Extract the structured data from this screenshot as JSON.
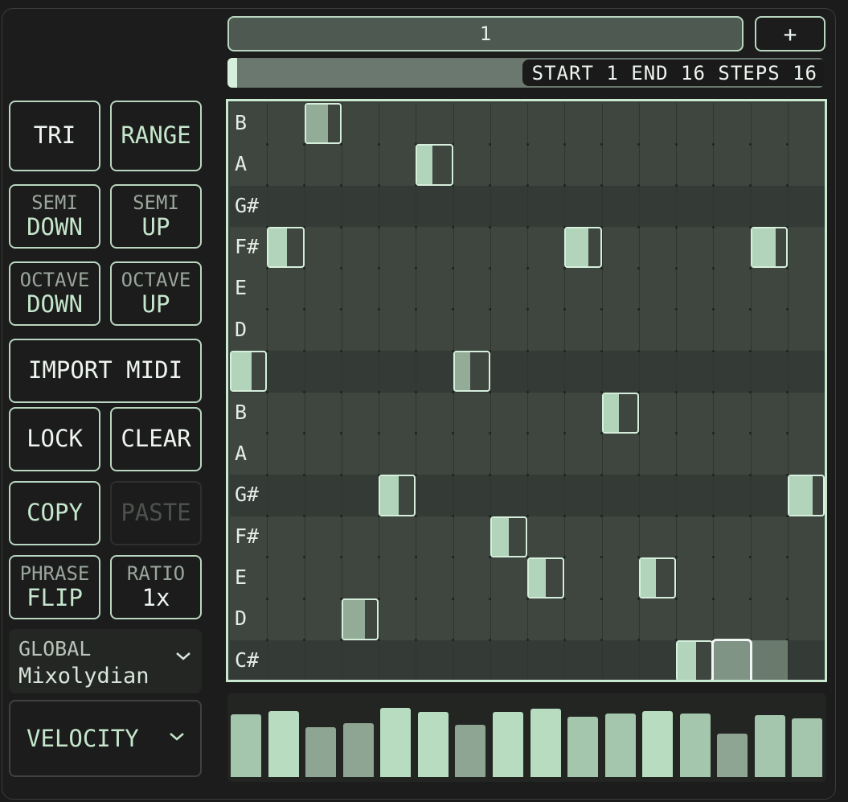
{
  "pattern": {
    "label": "1",
    "add_label": "+"
  },
  "range": {
    "text": "START 1 END 16 STEPS 16"
  },
  "buttons": {
    "tri": "TRI",
    "range": "RANGE",
    "semi_down": {
      "top": "SEMI",
      "bottom": "DOWN"
    },
    "semi_up": {
      "top": "SEMI",
      "bottom": "UP"
    },
    "octave_down": {
      "top": "OCTAVE",
      "bottom": "DOWN"
    },
    "octave_up": {
      "top": "OCTAVE",
      "bottom": "UP"
    },
    "import_midi": "IMPORT MIDI",
    "lock": "LOCK",
    "clear": "CLEAR",
    "copy": "COPY",
    "paste": "PASTE",
    "phrase_flip": {
      "top": "PHRASE",
      "bottom": "FLIP"
    },
    "ratio": {
      "top": "RATIO",
      "bottom": "1x"
    }
  },
  "scale": {
    "label": "GLOBAL",
    "value": "Mixolydian"
  },
  "lane": {
    "label": "VELOCITY"
  },
  "icons": {
    "dropdown": "chevron-down-icon",
    "add": "plus-icon"
  },
  "colors": {
    "accent": "#b9d6c0",
    "note": "#b2d4ba",
    "grid_dark": "#343a35",
    "grid_light": "#3e463f"
  },
  "note_rows": [
    "B",
    "A",
    "G#",
    "F#",
    "E",
    "D",
    "C#",
    "B",
    "A",
    "G#",
    "F#",
    "E",
    "D",
    "C#"
  ],
  "steps": 16,
  "notes": [
    {
      "step": 2,
      "row": 0,
      "fill": 0.65,
      "muted": true
    },
    {
      "step": 5,
      "row": 1,
      "fill": 0.45,
      "muted": false
    },
    {
      "step": 1,
      "row": 3,
      "fill": 0.55,
      "muted": false
    },
    {
      "step": 9,
      "row": 3,
      "fill": 0.65,
      "muted": false
    },
    {
      "step": 14,
      "row": 3,
      "fill": 0.7,
      "muted": false
    },
    {
      "step": 0,
      "row": 6,
      "fill": 0.6,
      "muted": false
    },
    {
      "step": 6,
      "row": 6,
      "fill": 0.45,
      "muted": true
    },
    {
      "step": 10,
      "row": 7,
      "fill": 0.45,
      "muted": false
    },
    {
      "step": 4,
      "row": 9,
      "fill": 0.55,
      "muted": false
    },
    {
      "step": 15,
      "row": 9,
      "fill": 0.7,
      "muted": false
    },
    {
      "step": 7,
      "row": 10,
      "fill": 0.5,
      "muted": false
    },
    {
      "step": 8,
      "row": 11,
      "fill": 0.5,
      "muted": false
    },
    {
      "step": 11,
      "row": 11,
      "fill": 0.45,
      "muted": false
    },
    {
      "step": 3,
      "row": 12,
      "fill": 0.65,
      "muted": true
    },
    {
      "step": 12,
      "row": 13,
      "fill": 0.55,
      "muted": false
    }
  ],
  "playhead": {
    "step": 13,
    "row": 13
  },
  "velocities": [
    0.72,
    0.76,
    0.57,
    0.62,
    0.8,
    0.75,
    0.6,
    0.75,
    0.79,
    0.69,
    0.73,
    0.76,
    0.73,
    0.5,
    0.71,
    0.68
  ]
}
